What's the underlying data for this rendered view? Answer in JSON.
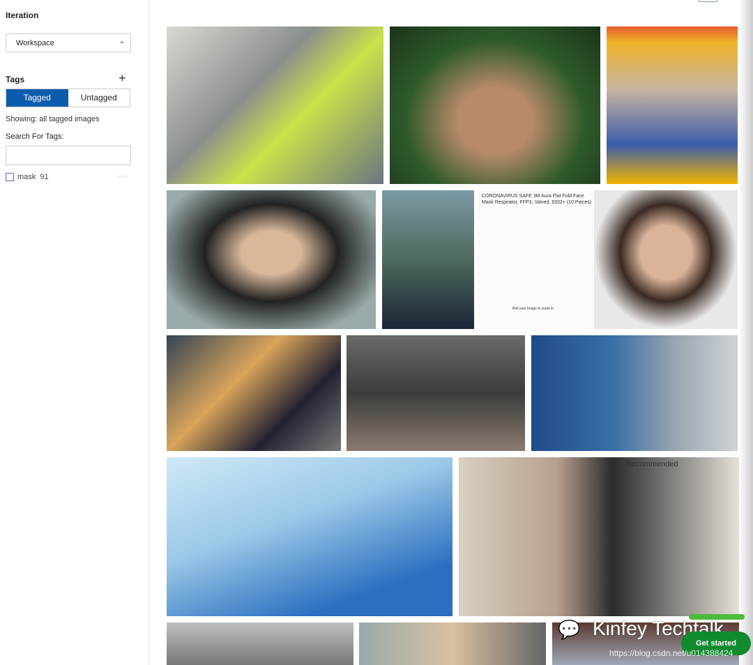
{
  "sidebar": {
    "iteration_label": "Iteration",
    "iteration_value": "Workspace",
    "tags_label": "Tags",
    "add_tag": "+",
    "tagged": "Tagged",
    "untagged": "Untagged",
    "showing": "Showing: all tagged images",
    "search_label": "Search For Tags:",
    "search_value": "",
    "tags": [
      {
        "name": "mask",
        "count": "91",
        "more": "···"
      }
    ]
  },
  "images": {
    "product_title": "CORONAVIRUS SAFE 3M Aura Flat Fold Face Mask Respirator, FFP3, Valved, 9332+ (10 Pieces)",
    "product_hint": "Roll over image to zoom in",
    "pharmacy_sign": "Recommended"
  },
  "overlay": {
    "watermark": "Kinfey Techtalk",
    "url": "https://blog.csdn.net/u014388424",
    "get_started": "Get started"
  }
}
